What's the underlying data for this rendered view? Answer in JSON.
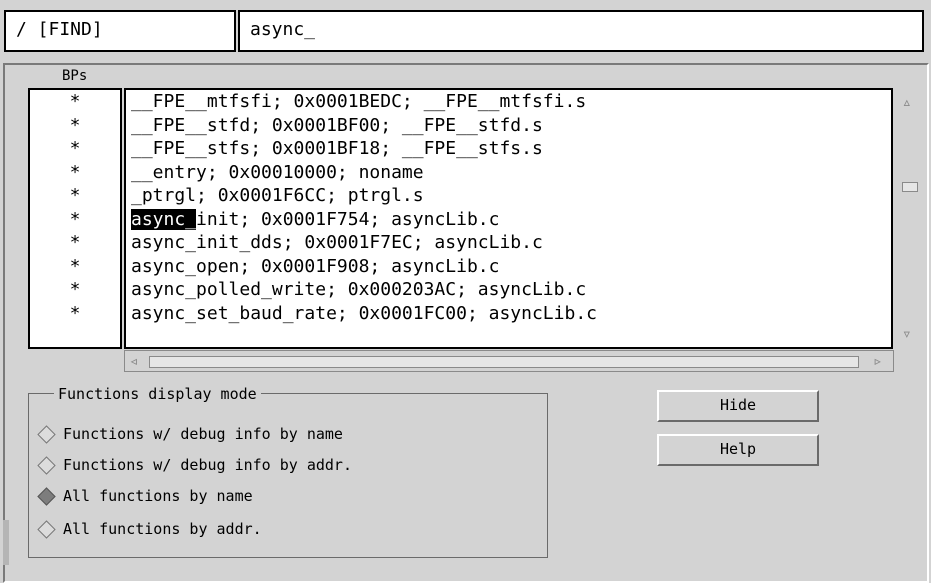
{
  "find_bar": {
    "label": "/ [FIND]",
    "input_value": "async_"
  },
  "bps_label": "BPs",
  "bp_marks": [
    "*",
    "*",
    "*",
    "*",
    "*",
    "*",
    "*",
    "*",
    "*",
    "*"
  ],
  "functions": [
    "__FPE__mtfsfi; 0x0001BEDC; __FPE__mtfsfi.s",
    "__FPE__stfd; 0x0001BF00; __FPE__stfd.s",
    "__FPE__stfs; 0x0001BF18; __FPE__stfs.s",
    "__entry; 0x00010000; noname",
    "_ptrgl; 0x0001F6CC; ptrgl.s",
    "init; 0x0001F754; asyncLib.c",
    "async_init_dds; 0x0001F7EC; asyncLib.c",
    "async_open; 0x0001F908; asyncLib.c",
    "async_polled_write; 0x000203AC; asyncLib.c",
    "async_set_baud_rate; 0x0001FC00; asyncLib.c"
  ],
  "highlight": "async_",
  "mode_group": {
    "title": "Functions display mode",
    "options": [
      "Functions w/ debug info by name",
      "Functions w/ debug info by addr.",
      "All functions by name",
      "All functions by addr."
    ],
    "selected_index": 2
  },
  "buttons": {
    "hide": "Hide",
    "help": "Help"
  },
  "icons": {
    "scroll_up": "up-triangle",
    "scroll_down": "down-triangle",
    "scroll_left": "left-triangle",
    "scroll_right": "right-triangle"
  }
}
